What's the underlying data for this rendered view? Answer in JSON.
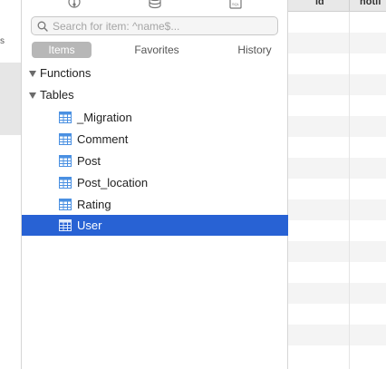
{
  "search": {
    "placeholder": "Search for item: ^name$..."
  },
  "tabs": [
    {
      "label": "Items",
      "active": true
    },
    {
      "label": "Favorites",
      "active": false
    },
    {
      "label": "History",
      "active": false
    }
  ],
  "tree": {
    "groups": [
      {
        "label": "Functions",
        "expanded": true
      },
      {
        "label": "Tables",
        "expanded": true
      }
    ],
    "tables": [
      {
        "label": "_Migration",
        "selected": false
      },
      {
        "label": "Comment",
        "selected": false
      },
      {
        "label": "Post",
        "selected": false
      },
      {
        "label": "Post_location",
        "selected": false
      },
      {
        "label": "Rating",
        "selected": false
      },
      {
        "label": "User",
        "selected": true
      }
    ]
  },
  "grid": {
    "columns": [
      "id",
      "notif"
    ]
  },
  "left_panel": {
    "text": "s"
  },
  "colors": {
    "selection": "#2862d4",
    "table_icon": "#4a90e2",
    "tab_active_bg": "#b7b7b7"
  },
  "icons": [
    "git-icon",
    "database-icon",
    "sql-icon",
    "search-icon",
    "disclosure-triangle-icon",
    "table-icon"
  ]
}
